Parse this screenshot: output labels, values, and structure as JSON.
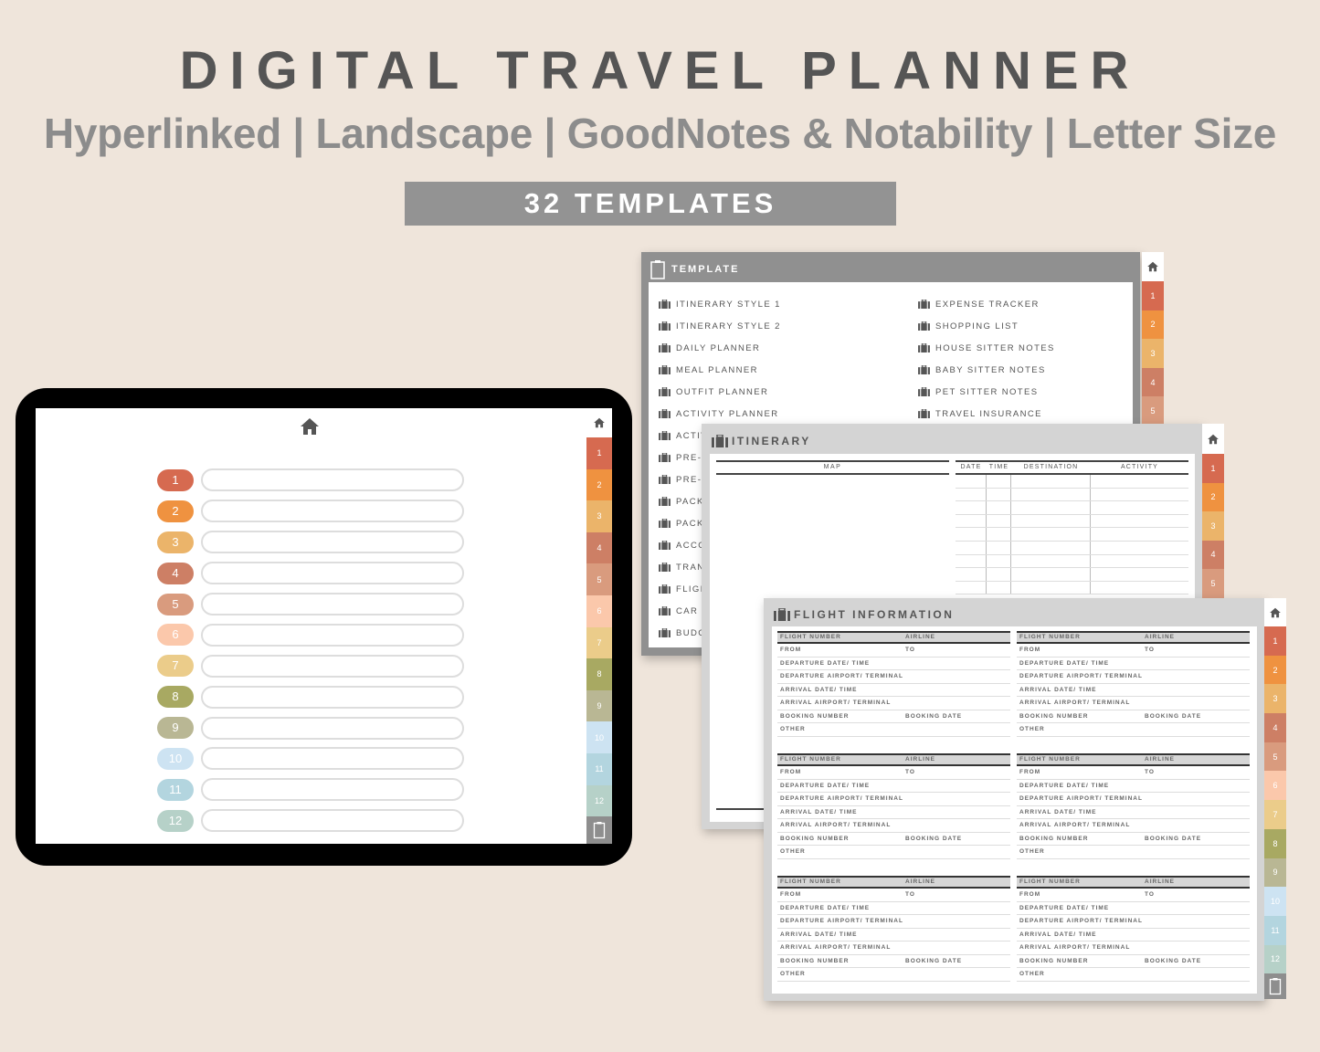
{
  "header": {
    "title": "DIGITAL TRAVEL PLANNER",
    "subtitle": "Hyperlinked | Landscape | GoodNotes & Notability | Letter Size",
    "badge": "32 TEMPLATES"
  },
  "tab_colors": [
    "#d66a50",
    "#ef9240",
    "#ebb46a",
    "#cd7f65",
    "#d99b7e",
    "#fbc8ab",
    "#ebcc8a",
    "#a8a962",
    "#b9b794",
    "#cde3f2",
    "#b3d5df",
    "#b6d1c8"
  ],
  "tabs": [
    "1",
    "2",
    "3",
    "4",
    "5",
    "6",
    "7",
    "8",
    "9",
    "10",
    "11",
    "12"
  ],
  "tablet": {
    "rows": [
      "1",
      "2",
      "3",
      "4",
      "5",
      "6",
      "7",
      "8",
      "9",
      "10",
      "11",
      "12"
    ]
  },
  "template_card": {
    "title": "TEMPLATE",
    "left_items": [
      "ITINERARY STYLE 1",
      "ITINERARY STYLE 2",
      "DAILY PLANNER",
      "MEAL PLANNER",
      "OUTFIT PLANNER",
      "ACTIVITY PLANNER",
      "ACTIV",
      "PRE-T CATE",
      "PRE-T",
      "PACK",
      "PACK",
      "ACCO",
      "TRAN",
      "FLIGH",
      "CAR I",
      "BUDG"
    ],
    "right_items": [
      "EXPENSE TRACKER",
      "SHOPPING LIST",
      "HOUSE SITTER NOTES",
      "BABY SITTER NOTES",
      "PET SITTER NOTES",
      "TRAVEL INSURANCE"
    ]
  },
  "itinerary_card": {
    "title": "ITINERARY",
    "map_label": "MAP",
    "columns": [
      "DATE",
      "TIME",
      "DESTINATION",
      "ACTIVITY"
    ]
  },
  "flight_card": {
    "title": "FLIGHT INFORMATION",
    "header_row": [
      "FLIGHT NUMBER",
      "AIRLINE"
    ],
    "rows": [
      [
        "FROM",
        "TO"
      ],
      [
        "DEPARTURE DATE/ TIME",
        ""
      ],
      [
        "DEPARTURE AIRPORT/ TERMINAL",
        ""
      ],
      [
        "ARRIVAL DATE/ TIME",
        ""
      ],
      [
        "ARRIVAL AIRPORT/ TERMINAL",
        ""
      ],
      [
        "BOOKING NUMBER",
        "BOOKING DATE"
      ],
      [
        "OTHER",
        ""
      ]
    ]
  }
}
